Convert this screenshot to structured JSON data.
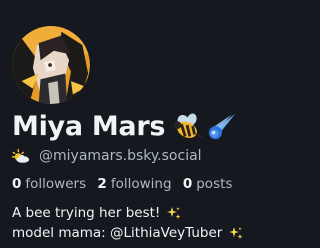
{
  "profile": {
    "display_name": "Miya Mars",
    "name_emojis": [
      "bee-icon",
      "comet-icon"
    ],
    "handle": "@miyamars.bsky.social",
    "handle_emoji": "sun-behind-cloud-icon",
    "stats": {
      "followers_count": "0",
      "followers_label": "followers",
      "following_count": "2",
      "following_label": "following",
      "posts_count": "0",
      "posts_label": "posts"
    },
    "bio": {
      "line1": "A bee trying her best!",
      "line2": "model mama: @LithiaVeyTuber"
    },
    "avatar": "avatar-image"
  }
}
